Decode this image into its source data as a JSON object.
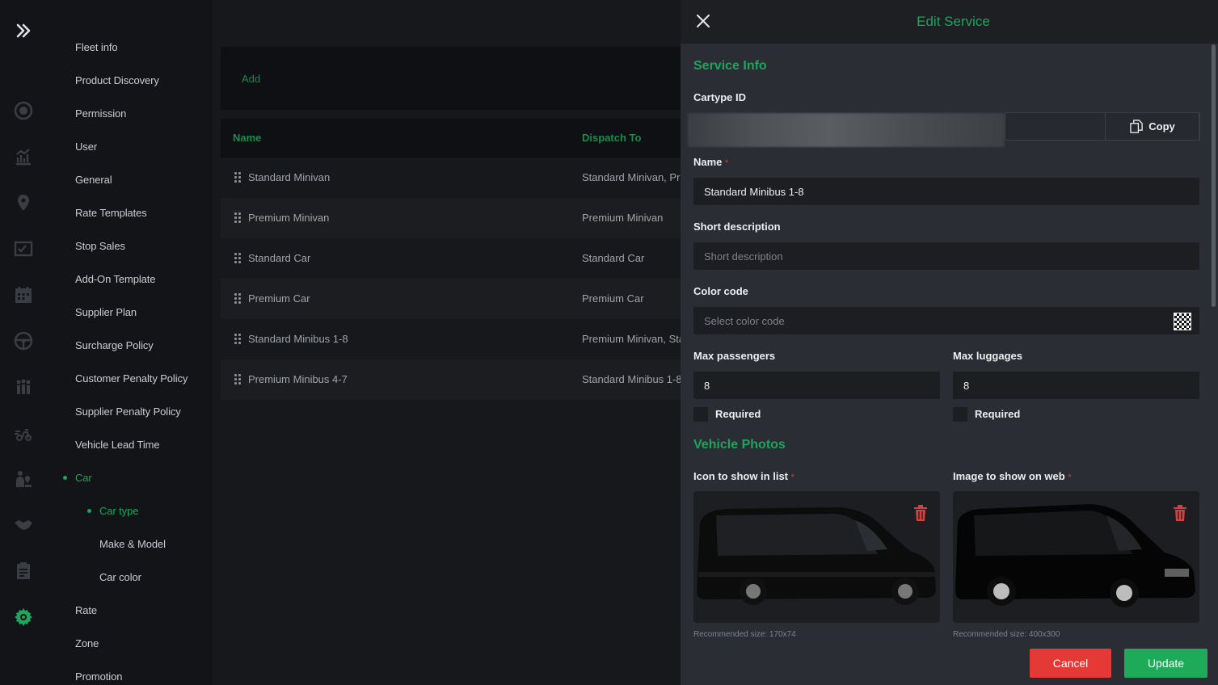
{
  "sidebar": {
    "items": [
      {
        "label": "Fleet info",
        "active": false
      },
      {
        "label": "Product Discovery",
        "active": false
      },
      {
        "label": "Permission",
        "active": false
      },
      {
        "label": "User",
        "active": false
      },
      {
        "label": "General",
        "active": false
      },
      {
        "label": "Rate Templates",
        "active": false
      },
      {
        "label": "Stop Sales",
        "active": false
      },
      {
        "label": "Add-On Template",
        "active": false
      },
      {
        "label": "Supplier Plan",
        "active": false
      },
      {
        "label": "Surcharge Policy",
        "active": false
      },
      {
        "label": "Customer Penalty Policy",
        "active": false
      },
      {
        "label": "Supplier Penalty Policy",
        "active": false
      },
      {
        "label": "Vehicle Lead Time",
        "active": false
      },
      {
        "label": "Car",
        "active": true
      },
      {
        "label": "Car type",
        "active": true
      },
      {
        "label": "Make & Model",
        "active": false
      },
      {
        "label": "Car color",
        "active": false
      },
      {
        "label": "Rate",
        "active": false
      },
      {
        "label": "Zone",
        "active": false
      },
      {
        "label": "Promotion",
        "active": false
      }
    ]
  },
  "rail": {
    "icons": [
      "expand-icon",
      "plus-circle-icon",
      "chart-icon",
      "location-pin-icon",
      "checklist-icon",
      "calendar-icon",
      "steering-wheel-icon",
      "group-icon",
      "delivery-icon",
      "people-map-icon",
      "handshake-icon",
      "clipboard-icon",
      "settings-gear-icon"
    ],
    "accent": "#1fa45c"
  },
  "main": {
    "add_label": "Add",
    "columns": [
      "Name",
      "Dispatch To"
    ],
    "rows": [
      {
        "name": "Standard Minivan",
        "dispatch": "Standard Minivan, Pr"
      },
      {
        "name": "Premium Minivan",
        "dispatch": "Premium Minivan"
      },
      {
        "name": "Standard Car",
        "dispatch": "Standard Car"
      },
      {
        "name": "Premium Car",
        "dispatch": "Premium Car"
      },
      {
        "name": "Standard Minibus 1-8",
        "dispatch": "Premium Minivan, Sta"
      },
      {
        "name": "Premium Minibus 4-7",
        "dispatch": "Standard Minibus 1-8"
      }
    ]
  },
  "panel": {
    "title": "Edit Service",
    "service_info_title": "Service Info",
    "cartype_id_label": "Cartype ID",
    "copy_label": "Copy",
    "name_label": "Name",
    "name_value": "Standard Minibus 1-8",
    "short_desc_label": "Short description",
    "short_desc_placeholder": "Short description",
    "color_code_label": "Color code",
    "color_code_placeholder": "Select color code",
    "max_passengers_label": "Max passengers",
    "max_passengers_value": "8",
    "max_luggages_label": "Max luggages",
    "max_luggages_value": "8",
    "required_label": "Required",
    "vehicle_photos_title": "Vehicle Photos",
    "icon_list_label": "Icon to show in list",
    "image_web_label": "Image to show on web",
    "icon_rec": "Recommended size: 170x74",
    "image_rec": "Recommended size: 400x300",
    "required_mark": "*",
    "cancel_label": "Cancel",
    "update_label": "Update"
  },
  "colors": {
    "accent_green": "#1fa45c",
    "cancel_red": "#e53935",
    "update_green": "#1faa59",
    "trash_red": "#d2413a"
  }
}
